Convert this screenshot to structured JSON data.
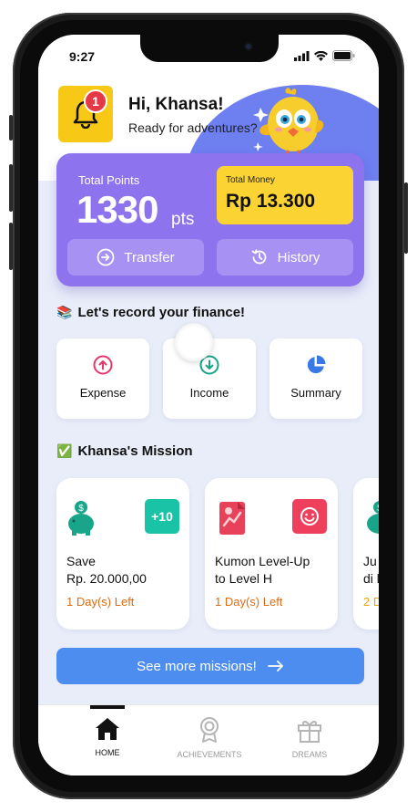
{
  "status": {
    "time": "9:27"
  },
  "header": {
    "notification_count": "1",
    "greeting": "Hi, Khansa!",
    "subtitle": "Ready for adventures?"
  },
  "points": {
    "label": "Total Points",
    "value": "1330",
    "unit": "pts",
    "money_label": "Total Money",
    "money_value": "Rp 13.300",
    "transfer_label": "Transfer",
    "history_label": "History"
  },
  "finance": {
    "emoji": "📚",
    "title": "Let's record your finance!",
    "actions": [
      {
        "label": "Expense",
        "icon": "arrow-up-circle-icon"
      },
      {
        "label": "Income",
        "icon": "arrow-down-circle-icon"
      },
      {
        "label": "Summary",
        "icon": "pie-chart-icon"
      }
    ]
  },
  "missions": {
    "emoji": "✅",
    "title": "Khansa's Mission",
    "items": [
      {
        "title": "Save\nRp. 20.000,00",
        "days_left": "1 Day(s) Left",
        "reward": "+10"
      },
      {
        "title": "Kumon Level-Up\nto Level H",
        "days_left": "1 Day(s) Left"
      },
      {
        "title": "Ju\ndi l",
        "days_left": "2 D"
      }
    ],
    "cta": "See more missions!"
  },
  "nav": {
    "items": [
      {
        "label": "HOME",
        "icon": "home-icon",
        "active": true
      },
      {
        "label": "ACHIEVEMENTS",
        "icon": "medal-icon",
        "active": false
      },
      {
        "label": "DREAMS",
        "icon": "gift-icon",
        "active": false
      }
    ]
  },
  "colors": {
    "primary": "#8e73ef",
    "yellow": "#fbd433",
    "blue": "#4e8df0",
    "expense": "#e8366b",
    "income": "#17a585",
    "orange": "#e06a12"
  }
}
